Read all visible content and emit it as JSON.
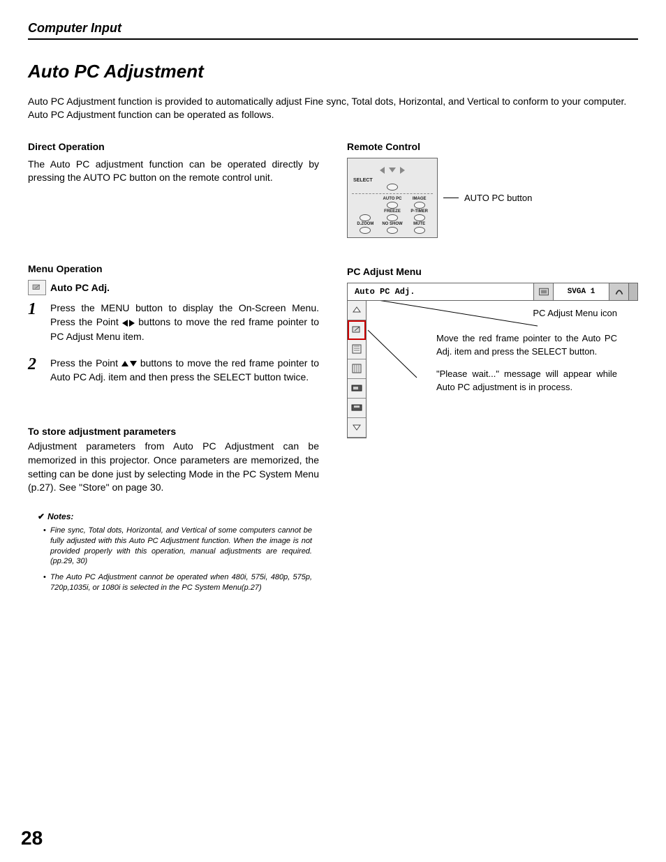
{
  "header": {
    "section": "Computer Input"
  },
  "title": "Auto PC Adjustment",
  "intro": "Auto PC Adjustment function is provided to automatically adjust Fine sync, Total dots, Horizontal, and Vertical to conform to your computer.  Auto PC Adjustment function can be operated as follows.",
  "left": {
    "direct_head": "Direct Operation",
    "direct_body": "The Auto PC adjustment function can be operated directly by pressing the AUTO PC button on the remote control unit.",
    "menu_head": "Menu Operation",
    "autopc_label": "Auto PC Adj.",
    "step1_num": "1",
    "step1_text_a": "Press the MENU button to display the On-Screen Menu.  Press the Point ",
    "step1_text_b": " buttons to move the red frame pointer to PC Adjust Menu item.",
    "step2_num": "2",
    "step2_text_a": "Press the Point ",
    "step2_text_b": " buttons to move the red frame pointer to Auto PC Adj. item and then press the SELECT button twice.",
    "store_head": "To store adjustment parameters",
    "store_body": "Adjustment parameters from Auto PC Adjustment can be memorized in this projector.  Once parameters are memorized, the setting can be done just by selecting Mode in the PC System Menu (p.27).  See \"Store\" on page 30.",
    "notes_head": "Notes:",
    "note1": "Fine sync, Total dots, Horizontal, and Vertical of some computers cannot be fully adjusted with this Auto PC Adjustment function. When the image is not provided properly with this operation, manual adjustments are required.  (pp.29, 30)",
    "note2": "The Auto PC Adjustment cannot be operated when 480i, 575i, 480p, 575p, 720p,1035i, or 1080i is selected in the PC System Menu(p.27)"
  },
  "right": {
    "remote_head": "Remote Control",
    "remote": {
      "select": "SELECT",
      "dzoom": "D.ZOOM",
      "autopc": "AUTO PC",
      "image": "IMAGE",
      "freeze": "FREEZE",
      "ptimer": "P-TIMER",
      "noshow": "NO SHOW",
      "mute": "MUTE"
    },
    "remote_callout": "AUTO PC button",
    "pcadj_head": "PC Adjust Menu",
    "menubar": {
      "title": "Auto PC Adj.",
      "mode": "SVGA 1"
    },
    "caption_icon": "PC Adjust Menu icon",
    "note_move": "Move the red frame pointer to the Auto PC Adj. item and press the SELECT button.",
    "note_wait": "\"Please wait...\" message will appear while Auto PC adjustment is in process."
  },
  "page": "28"
}
